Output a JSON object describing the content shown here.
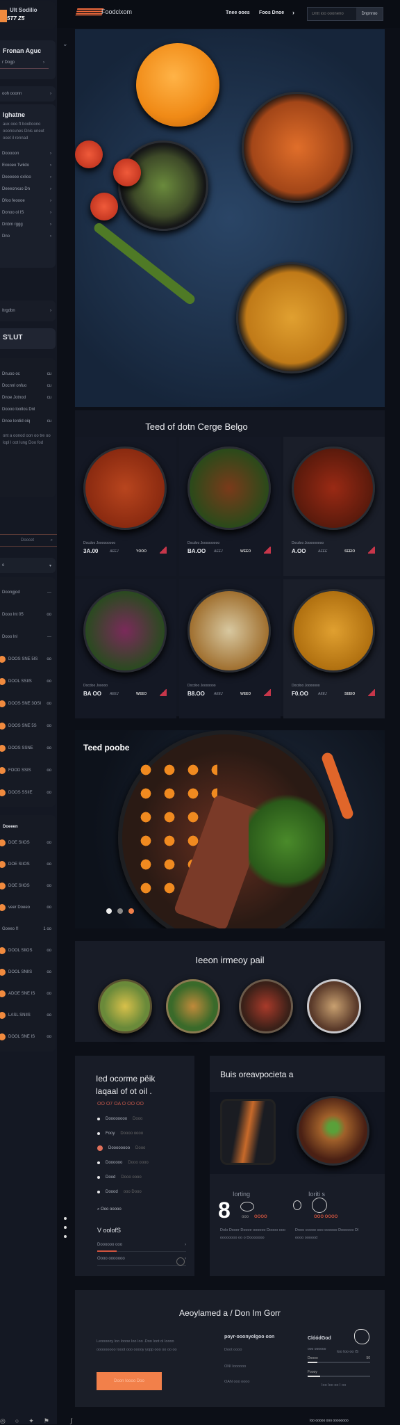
{
  "colors": {
    "accent": "#f0804a",
    "bg": "#0c0f17",
    "panel": "#181c27"
  },
  "sidebar": {
    "brand": "Ult Sodilio",
    "brand_sub": "5T7 Z5",
    "panel_title": "Fronan Aguc",
    "panel_item": "r Dogp",
    "bar_item": "ooh ooonn",
    "section_title": "Ighatne",
    "section_desc": "aux ooo ft booltoono oooncunes Dnis uneut ooet il rennad",
    "menu": [
      "Dooooon",
      "Exooeo Twiido",
      "Deeeeee oxlioo",
      "Deeeonxuo Dn",
      "Dfoo feoooe",
      "Donoo ol IS",
      "Dnbm rggg",
      "Dno"
    ],
    "group_title": "Itrgdbn",
    "group2_title": "S'LUT",
    "list": [
      {
        "label": "Dnuoo oc",
        "count": "cu"
      },
      {
        "label": "Docnnl onfuo",
        "count": "cu"
      },
      {
        "label": "Dnoe Jotnod",
        "count": "cu"
      },
      {
        "label": "Doooo lootlos Dnl",
        "count": ""
      },
      {
        "label": "Dnoe lordid oiq",
        "count": "cu"
      }
    ],
    "note": "ont a oonod oon oo tre oo lopl l oot lung Doo fod",
    "tabs": {
      "label": "Doocet",
      "icon": "search-icon"
    },
    "select": "o",
    "rows": [
      {
        "label": "Doongjod",
        "count": "---"
      },
      {
        "label": "Dooo lnt 05",
        "count": "oo"
      },
      {
        "label": "Dooo lnl",
        "count": "---"
      },
      {
        "label": "DOOS SNE 5IS",
        "count": "oo"
      },
      {
        "label": "DOOL SSIIS",
        "count": "oo"
      },
      {
        "label": "DOOS SNE 3OSI",
        "count": "oo"
      },
      {
        "label": "DOOS SNE 5S",
        "count": "oo"
      },
      {
        "label": "DOOS SSNE",
        "count": "oo"
      },
      {
        "label": "FOOD SSIS",
        "count": "oo"
      },
      {
        "label": "DOOS SSIIE",
        "count": "oo"
      }
    ],
    "group3_title": "Doeeen",
    "rows2": [
      {
        "label": "DOE SIIOS",
        "count": "oo"
      },
      {
        "label": "DOE SIIOS",
        "count": "oo"
      },
      {
        "label": "DOE SIIOS",
        "count": "oo"
      },
      {
        "label": "veer Doeeo",
        "count": "oo"
      },
      {
        "label": "Goeeo l'l",
        "count": "1 oo"
      },
      {
        "label": "DOOL SIIOS",
        "count": "oo"
      },
      {
        "label": "DOOL SNIIS",
        "count": "oo"
      },
      {
        "label": "ADOE SNE IS",
        "count": "oo"
      },
      {
        "label": "LASL SNIIS",
        "count": "oo"
      },
      {
        "label": "DOOL SNE IS",
        "count": "oo"
      }
    ]
  },
  "header": {
    "logo": "Foodclxom",
    "nav": [
      "Tnee ooes",
      "Foos Dnoe"
    ],
    "search_placeholder": "Dntt ioo oooneno",
    "search_button": "Dnpnroo"
  },
  "grid": {
    "title": "Teed of dotn Cerge Belgo",
    "cards": [
      {
        "caption": "Docdoo Jooooooooo",
        "price": "3A.00",
        "tag": "AEEJ",
        "extra": "YOOO"
      },
      {
        "caption": "Docdoo Jooooooooo",
        "price": "BA.OO",
        "tag": "AEEJ",
        "extra": "WEEO"
      },
      {
        "caption": "Docdoo Jooooooooo",
        "price": "A.OO",
        "tag": "AEEE",
        "extra": "SEEIO"
      },
      {
        "caption": "Docdoo Jooooo",
        "price": "BA OO",
        "tag": "AEEJ",
        "extra": "WEEO"
      },
      {
        "caption": "Docdoo Jooooooo",
        "price": "B8.OO",
        "tag": "AEEJ",
        "extra": "WEEO"
      },
      {
        "caption": "Docdoo Jooooooo",
        "price": "F0.OO",
        "tag": "AEEJ",
        "extra": "SEEIO"
      }
    ]
  },
  "feature": {
    "title": "Teed poobe",
    "slides": 3,
    "active_slide": 3
  },
  "popular": {
    "title": "Ieeon irmeoy pail"
  },
  "recipe": {
    "title": "Ied ocorme pëik laqaal of ot oil .",
    "subtitle": "OO O7 OA O OO OO",
    "items": [
      {
        "a": "Doooooooo",
        "b": "Dooo"
      },
      {
        "a": "Fooy",
        "b": "Doooo  oooo"
      },
      {
        "a": "Doooooooo",
        "b": "Dooo"
      },
      {
        "a": "Doooooo",
        "b": "Dooo  oooo"
      },
      {
        "a": "Dood",
        "b": "Dooo  oooo"
      },
      {
        "a": "Doood",
        "b": "ooo  Dooo"
      }
    ],
    "search": "Ooo ooooo",
    "sub_title": "V oolofS",
    "links": [
      "Doooooo ooo",
      "Oooo ooooooo"
    ]
  },
  "stats": {
    "title": "Buis oreavpocieta a",
    "s1_label": "Iorting",
    "s1_value": "8",
    "s1_note": "ooo",
    "s1_badge": "OOOO",
    "s2_label": "Ioriti s",
    "s2_badge": "OOO OOOO",
    "s1_desc": "Dolo Dooer Doooe oooooo Doooo ooo oooooooo oo o Dooooooo",
    "s2_desc": "Dnoo ooooo ooo oooooo Doooooo Dl oooo oooood"
  },
  "footer": {
    "title": "Aeoylamed a / Don Im Gorr",
    "desc": "Leoooooy loo Ioooe Ioo Ioo .Doo Ioot ol Ioooo ooooooooo Iooot ooo ooooy yopp ooo oo oo oo",
    "cta": "Doon Ioooo Doo",
    "email": "poyr·ooonyolgoo oon",
    "lines": [
      "Doot oooo",
      "ONI Ioooooo",
      "OAN ooo oooo"
    ],
    "widget_title": "ClóódGod",
    "widget_sub": "ooo oooooo",
    "widget_right": "Ioo Ioo oo IS",
    "bar1": "Doooo",
    "bar1_val": "50",
    "bar2": "Foooy",
    "widget_foot": "Ioo Ioo oo I oo",
    "bar1_fill": 0.15,
    "bar2_fill": 0.2
  },
  "bottom": {
    "right": "Ioo ooooo ooo oooooooo"
  }
}
